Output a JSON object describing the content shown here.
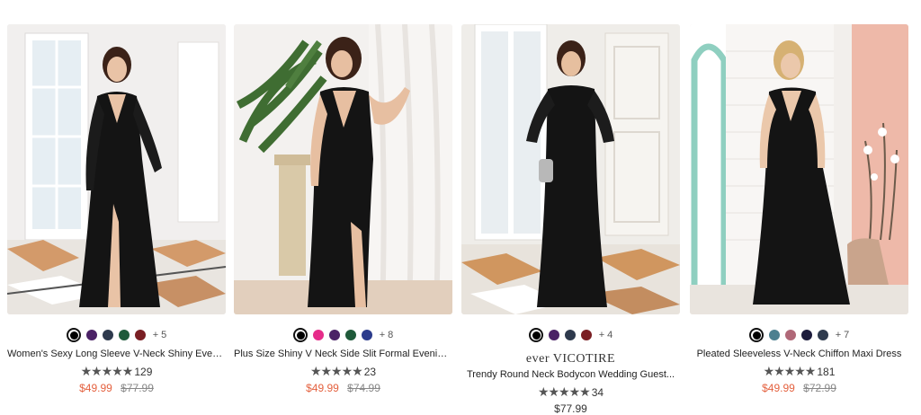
{
  "colors": {
    "sale": "#e4613f",
    "original": "#888888",
    "stars": "#555555"
  },
  "products": [
    {
      "name": "Women's Sexy Long Sleeve V-Neck Shiny Eveni...",
      "swatches": [
        "#000000",
        "#4b2266",
        "#2e3a4d",
        "#1f5a3a",
        "#7a1f24"
      ],
      "selected_swatch": 0,
      "more_colors": "+ 5",
      "stars": "★★★★★",
      "rating_count": "129",
      "sale_price": "$49.99",
      "original_price": "$77.99"
    },
    {
      "name": "Plus Size Shiny V Neck Side Slit Formal Evening...",
      "swatches": [
        "#000000",
        "#e62c8a",
        "#4b2266",
        "#1f5a3a",
        "#2c3c8c"
      ],
      "selected_swatch": 0,
      "more_colors": "+ 8",
      "stars": "★★★★★",
      "rating_count": "23",
      "sale_price": "$49.99",
      "original_price": "$74.99"
    },
    {
      "brand": "ever VICOTIRE",
      "name": "Trendy Round Neck Bodycon Wedding Guest...",
      "swatches": [
        "#000000",
        "#4b2266",
        "#2e3a4d",
        "#7a1f24"
      ],
      "selected_swatch": 0,
      "more_colors": "+ 4",
      "stars": "★★★★★",
      "rating_count": "34",
      "price": "$77.99"
    },
    {
      "name": "Pleated Sleeveless V-Neck Chiffon Maxi Dress",
      "swatches": [
        "#000000",
        "#4d8090",
        "#b06878",
        "#1c1c3c",
        "#2e3a4d"
      ],
      "selected_swatch": 0,
      "more_colors": "+ 7",
      "stars": "★★★★★",
      "rating_count": "181",
      "sale_price": "$49.99",
      "original_price": "$72.99"
    }
  ]
}
